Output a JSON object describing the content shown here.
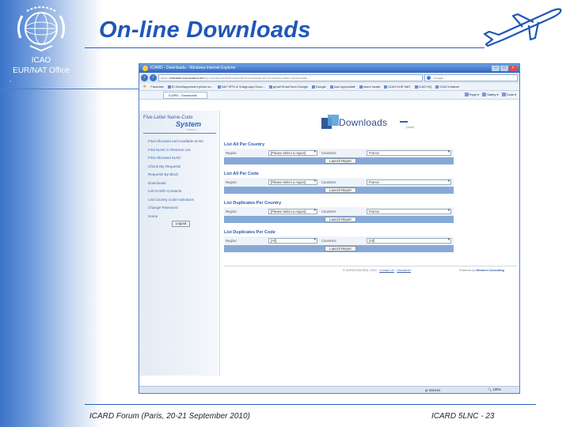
{
  "slide": {
    "title": "On-line Downloads",
    "org_line1": "ICAO",
    "org_line2": "EUR/NAT Office",
    "footer_left": "ICARD Forum (Paris, 20-21 September 2010)",
    "footer_right": "ICARD 5LNC - 23",
    "colors": {
      "title": "#1f56b8",
      "left_gradient": "#3b74c9",
      "rule": "#2a5fbf"
    }
  },
  "browser": {
    "window_title": "ICARD - Downloads - Windows Internet Explorer",
    "address_prefix": "https://",
    "address_host": "extranet.eurocontrol.int",
    "address_rest": "/http://localhost:8080/icard/5LNC/frameset.do?id=0&menuItem=downloads",
    "search_placeholder": "Google",
    "favorites_label": "Favorites",
    "favorites": [
      "EI Developpement photo nu...",
      "NAT SPG & Subgroups Docu...",
      "gmail Email from Google",
      "Google",
      "icao logon/staff",
      "heure locale",
      "ICAO EUR NAT",
      "ICAO HQ",
      "ICAO Intranet"
    ],
    "tab_label": "ICARD - Downloads",
    "commands": [
      "Page ▾",
      "Safety ▾",
      "Tools ▾"
    ],
    "status_zone": "Internet",
    "zoom": "100%"
  },
  "app": {
    "brand_top": "Five-Letter Name-Code",
    "brand_system": "System",
    "brand_sub": "Version 2",
    "menu": [
      "Find Allocated and Available 5LNC",
      "Find 5LNC in Reserve List",
      "Find Allocated 5LNC",
      "Check My Requests",
      "Requests By Block",
      "Downloads",
      "List ICARD Contacts",
      "List Country Code Indicators",
      "Change Password",
      "Home"
    ],
    "logout_label": "Logout",
    "downloads_word": "Downloads",
    "downloads_hint": "[close]",
    "sections": [
      {
        "title": "List All Per Country",
        "region_label": "Region:",
        "region_value": "[Please Select a region]",
        "countries_label": "Countries:",
        "country_value": "France",
        "launch_label": "Launch Report"
      },
      {
        "title": "List All Per Code",
        "region_label": "Region:",
        "region_value": "[Please Select a region]",
        "countries_label": "Countries:",
        "country_value": "France",
        "launch_label": "Launch Report"
      },
      {
        "title": "List Duplicates Per Country",
        "region_label": "Region:",
        "region_value": "[Please Select a region]",
        "countries_label": "Countries:",
        "country_value": "France",
        "launch_label": "Launch Report"
      },
      {
        "title": "List Duplicates Per Code",
        "region_label": "Region:",
        "region_value": "[All]",
        "countries_label": "Countries:",
        "country_value": "[All]",
        "launch_label": "Launch Report"
      }
    ],
    "footer_copyright": "© EUROCONTROL 2010 -",
    "footer_contact": "Contact Us",
    "footer_disclaimer": "Disclaimer",
    "powered_label": "Powered by",
    "powered_brand": "Western Consulting"
  }
}
